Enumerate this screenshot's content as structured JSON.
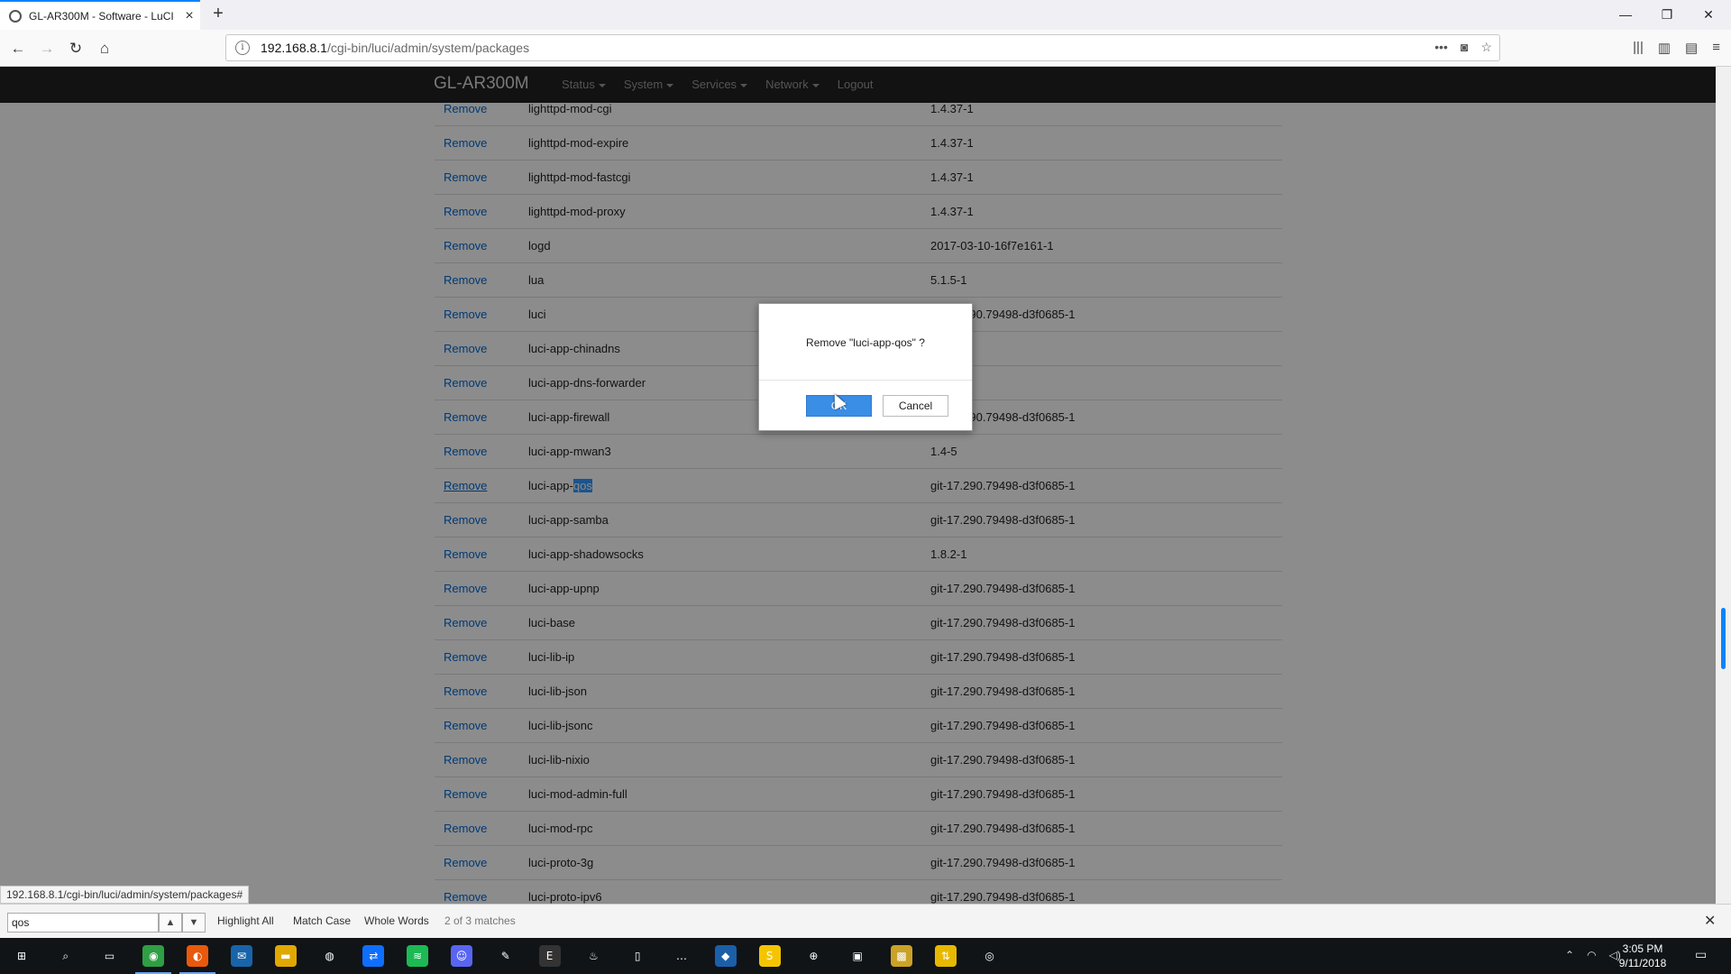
{
  "browser": {
    "tab_title": "GL-AR300M - Software - LuCI",
    "url_host": "192.168.8.1",
    "url_path": "/cgi-bin/luci/admin/system/packages",
    "status_url": "192.168.8.1/cgi-bin/luci/admin/system/packages#"
  },
  "luci": {
    "brand": "GL-AR300M",
    "menu": [
      "Status",
      "System",
      "Services",
      "Network",
      "Logout"
    ]
  },
  "packages": {
    "action_label": "Remove",
    "rows": [
      {
        "name": "lighttpd-mod-cgi",
        "version": "1.4.37-1"
      },
      {
        "name": "lighttpd-mod-expire",
        "version": "1.4.37-1"
      },
      {
        "name": "lighttpd-mod-fastcgi",
        "version": "1.4.37-1"
      },
      {
        "name": "lighttpd-mod-proxy",
        "version": "1.4.37-1"
      },
      {
        "name": "logd",
        "version": "2017-03-10-16f7e161-1"
      },
      {
        "name": "lua",
        "version": "5.1.5-1"
      },
      {
        "name": "luci",
        "version": "git-17.290.79498-d3f0685-1"
      },
      {
        "name": "luci-app-chinadns",
        "version": ""
      },
      {
        "name": "luci-app-dns-forwarder",
        "version": ""
      },
      {
        "name": "luci-app-firewall",
        "version": "git-17.290.79498-d3f0685-1"
      },
      {
        "name": "luci-app-mwan3",
        "version": "1.4-5"
      },
      {
        "name": "luci-app-qos",
        "version": "git-17.290.79498-d3f0685-1"
      },
      {
        "name": "luci-app-samba",
        "version": "git-17.290.79498-d3f0685-1"
      },
      {
        "name": "luci-app-shadowsocks",
        "version": "1.8.2-1"
      },
      {
        "name": "luci-app-upnp",
        "version": "git-17.290.79498-d3f0685-1"
      },
      {
        "name": "luci-base",
        "version": "git-17.290.79498-d3f0685-1"
      },
      {
        "name": "luci-lib-ip",
        "version": "git-17.290.79498-d3f0685-1"
      },
      {
        "name": "luci-lib-json",
        "version": "git-17.290.79498-d3f0685-1"
      },
      {
        "name": "luci-lib-jsonc",
        "version": "git-17.290.79498-d3f0685-1"
      },
      {
        "name": "luci-lib-nixio",
        "version": "git-17.290.79498-d3f0685-1"
      },
      {
        "name": "luci-mod-admin-full",
        "version": "git-17.290.79498-d3f0685-1"
      },
      {
        "name": "luci-mod-rpc",
        "version": "git-17.290.79498-d3f0685-1"
      },
      {
        "name": "luci-proto-3g",
        "version": "git-17.290.79498-d3f0685-1"
      },
      {
        "name": "luci-proto-ipv6",
        "version": "git-17.290.79498-d3f0685-1"
      }
    ]
  },
  "dialog": {
    "message": "Remove \"luci-app-qos\" ?",
    "ok_label": "OK",
    "cancel_label": "Cancel"
  },
  "findbar": {
    "query": "qos",
    "highlight_all": "Highlight All",
    "match_case": "Match Case",
    "whole_words": "Whole Words",
    "match_count": "2 of 3 matches"
  },
  "taskbar": {
    "time": "3:05 PM",
    "date": "9/11/2018",
    "icons": [
      "start-icon",
      "search-icon",
      "task-view-icon",
      "chrome-icon",
      "firefox-icon",
      "thunderbird-icon",
      "file-explorer-icon",
      "keepass-icon",
      "teamviewer-icon",
      "spotify-icon",
      "discord-icon",
      "notepad-icon",
      "epic-games-icon",
      "steam-icon",
      "document-icon",
      "chat-icon",
      "vscode-icon",
      "app-s-icon",
      "network-app-icon",
      "remote-desktop-icon",
      "sticky-notes-icon",
      "winscp-icon",
      "steam-alt-icon"
    ]
  },
  "colors": {
    "link": "#0069d6",
    "luci_header": "#222222",
    "ok_button": "#3a8ee6",
    "find_highlight": "#3399ff"
  }
}
